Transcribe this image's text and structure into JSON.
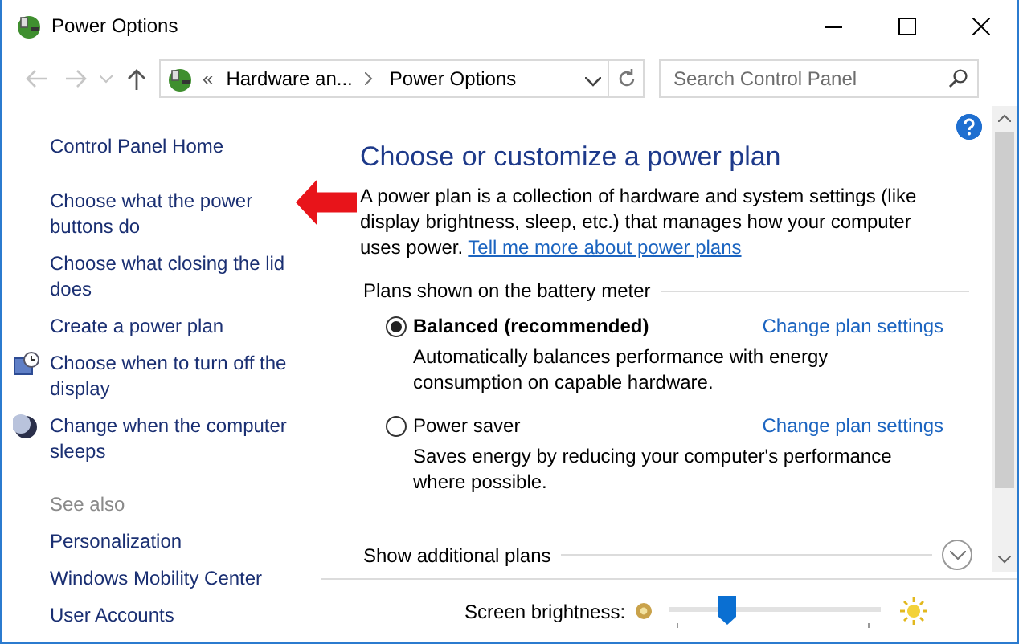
{
  "window": {
    "title": "Power Options"
  },
  "address_bar": {
    "crumbs": [
      "Hardware an...",
      "Power Options"
    ],
    "overflow": "«"
  },
  "search": {
    "placeholder": "Search Control Panel"
  },
  "sidebar": {
    "items": [
      {
        "label": "Control Panel Home"
      },
      {
        "label": "Choose what the power buttons do"
      },
      {
        "label": "Choose what closing the lid does"
      },
      {
        "label": "Create a power plan"
      },
      {
        "label": "Choose when to turn off the display"
      },
      {
        "label": "Change when the computer sleeps"
      }
    ],
    "see_also_label": "See also",
    "see_also": [
      "Personalization",
      "Windows Mobility Center",
      "User Accounts"
    ]
  },
  "main": {
    "heading": "Choose or customize a power plan",
    "description": "A power plan is a collection of hardware and system settings (like display brightness, sleep, etc.) that manages how your computer uses power.",
    "learn_more_link": "Tell me more about power plans",
    "group_label": "Plans shown on the battery meter",
    "plans": [
      {
        "name": "Balanced (recommended)",
        "selected": true,
        "link": "Change plan settings",
        "description": "Automatically balances performance with energy consumption on capable hardware."
      },
      {
        "name": "Power saver",
        "selected": false,
        "link": "Change plan settings",
        "description": "Saves energy by reducing your computer's performance where possible."
      }
    ],
    "additional_plans": "Show additional plans"
  },
  "brightness": {
    "label": "Screen brightness:",
    "level": 0.27
  }
}
